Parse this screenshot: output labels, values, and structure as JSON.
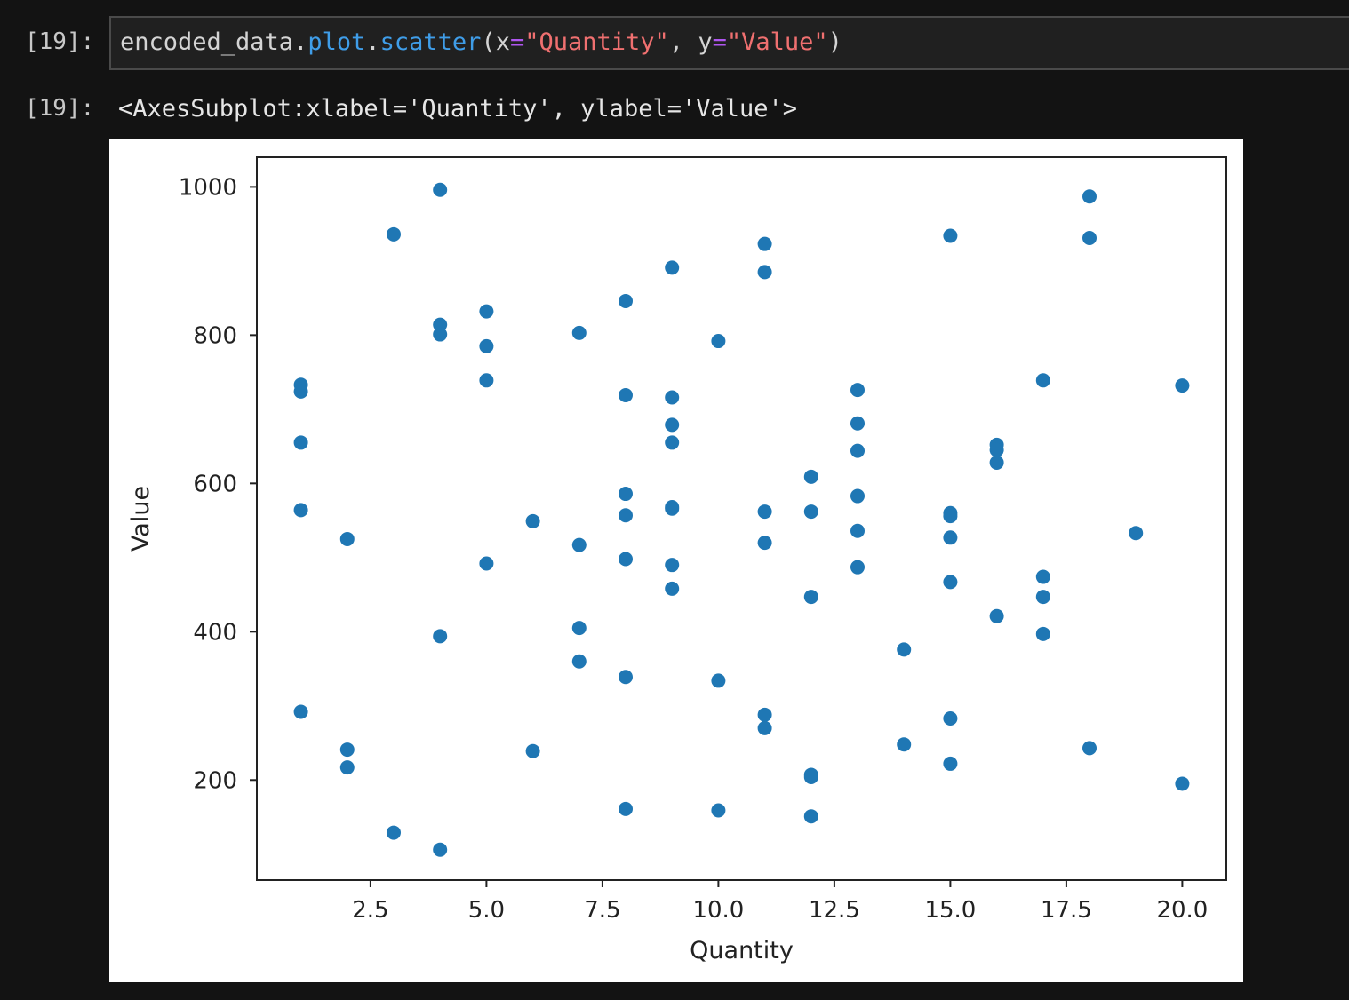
{
  "cell": {
    "input_prompt": "[19]:",
    "output_prompt": "[19]:",
    "code": {
      "obj": "encoded_data",
      "dot1": ".",
      "method1": "plot",
      "dot2": ".",
      "method2": "scatter",
      "open": "(",
      "arg1_name": "x",
      "eq1": "=",
      "arg1_val": "\"Quantity\"",
      "sep": ", ",
      "arg2_name": "y",
      "eq2": "=",
      "arg2_val": "\"Value\"",
      "close": ")"
    },
    "output_text": "<AxesSubplot:xlabel='Quantity', ylabel='Value'>"
  },
  "colors": {
    "marker": "#1f77b4",
    "string": "#f07070",
    "function": "#3f9de8",
    "operator": "#b056f0"
  },
  "chart_data": {
    "type": "scatter",
    "title": "",
    "xlabel": "Quantity",
    "ylabel": "Value",
    "xlim": [
      0.05,
      20.95
    ],
    "ylim": [
      65,
      1040
    ],
    "xticks": [
      2.5,
      5.0,
      7.5,
      10.0,
      12.5,
      15.0,
      17.5,
      20.0
    ],
    "xtick_labels": [
      "2.5",
      "5.0",
      "7.5",
      "10.0",
      "12.5",
      "15.0",
      "17.5",
      "20.0"
    ],
    "yticks": [
      200,
      400,
      600,
      800,
      1000
    ],
    "ytick_labels": [
      "200",
      "400",
      "600",
      "800",
      "1000"
    ],
    "grid": false,
    "legend": "none",
    "points": [
      [
        1,
        733
      ],
      [
        1,
        724
      ],
      [
        1,
        655
      ],
      [
        1,
        564
      ],
      [
        1,
        292
      ],
      [
        2,
        525
      ],
      [
        2,
        241
      ],
      [
        2,
        217
      ],
      [
        3,
        936
      ],
      [
        3,
        129
      ],
      [
        4,
        996
      ],
      [
        4,
        814
      ],
      [
        4,
        801
      ],
      [
        4,
        394
      ],
      [
        4,
        106
      ],
      [
        5,
        832
      ],
      [
        5,
        785
      ],
      [
        5,
        739
      ],
      [
        5,
        492
      ],
      [
        6,
        549
      ],
      [
        6,
        239
      ],
      [
        7,
        803
      ],
      [
        7,
        517
      ],
      [
        7,
        405
      ],
      [
        7,
        360
      ],
      [
        8,
        846
      ],
      [
        8,
        719
      ],
      [
        8,
        586
      ],
      [
        8,
        557
      ],
      [
        8,
        498
      ],
      [
        8,
        339
      ],
      [
        8,
        161
      ],
      [
        9,
        891
      ],
      [
        9,
        716
      ],
      [
        9,
        679
      ],
      [
        9,
        655
      ],
      [
        9,
        568
      ],
      [
        9,
        566
      ],
      [
        9,
        490
      ],
      [
        9,
        458
      ],
      [
        10,
        792
      ],
      [
        10,
        334
      ],
      [
        10,
        159
      ],
      [
        11,
        923
      ],
      [
        11,
        885
      ],
      [
        11,
        562
      ],
      [
        11,
        520
      ],
      [
        11,
        288
      ],
      [
        11,
        270
      ],
      [
        12,
        609
      ],
      [
        12,
        562
      ],
      [
        12,
        447
      ],
      [
        12,
        207
      ],
      [
        12,
        204
      ],
      [
        12,
        151
      ],
      [
        13,
        726
      ],
      [
        13,
        681
      ],
      [
        13,
        644
      ],
      [
        13,
        583
      ],
      [
        13,
        536
      ],
      [
        13,
        487
      ],
      [
        14,
        376
      ],
      [
        14,
        248
      ],
      [
        15,
        934
      ],
      [
        15,
        560
      ],
      [
        15,
        556
      ],
      [
        15,
        527
      ],
      [
        15,
        467
      ],
      [
        15,
        283
      ],
      [
        15,
        222
      ],
      [
        16,
        652
      ],
      [
        16,
        645
      ],
      [
        16,
        628
      ],
      [
        16,
        421
      ],
      [
        17,
        739
      ],
      [
        17,
        474
      ],
      [
        17,
        447
      ],
      [
        17,
        397
      ],
      [
        18,
        987
      ],
      [
        18,
        931
      ],
      [
        18,
        243
      ],
      [
        19,
        533
      ],
      [
        20,
        732
      ],
      [
        20,
        195
      ]
    ]
  }
}
